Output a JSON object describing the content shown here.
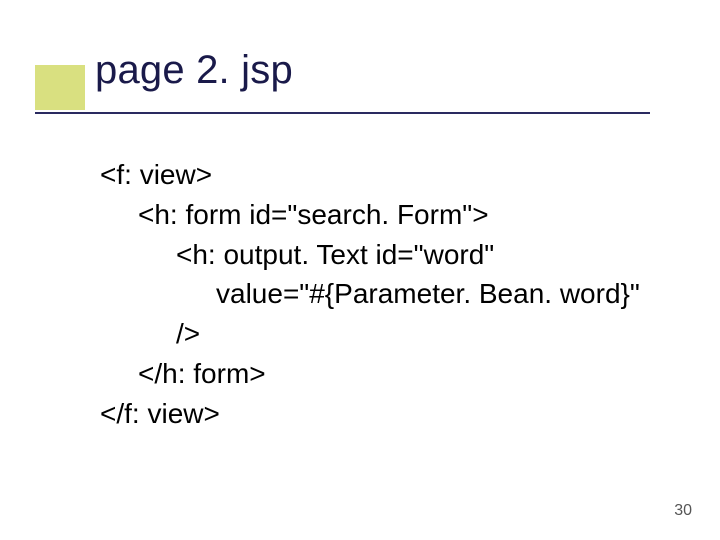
{
  "title": "page 2. jsp",
  "code": {
    "l1": "<f: view>",
    "l2": "<h: form id=\"search. Form\">",
    "l3": "<h: output. Text id=\"word\"",
    "l4": "value=\"#{Parameter. Bean. word}\"",
    "l5": "/>",
    "l6": "</h: form>",
    "l7": "</f: view>"
  },
  "page_number": "30"
}
